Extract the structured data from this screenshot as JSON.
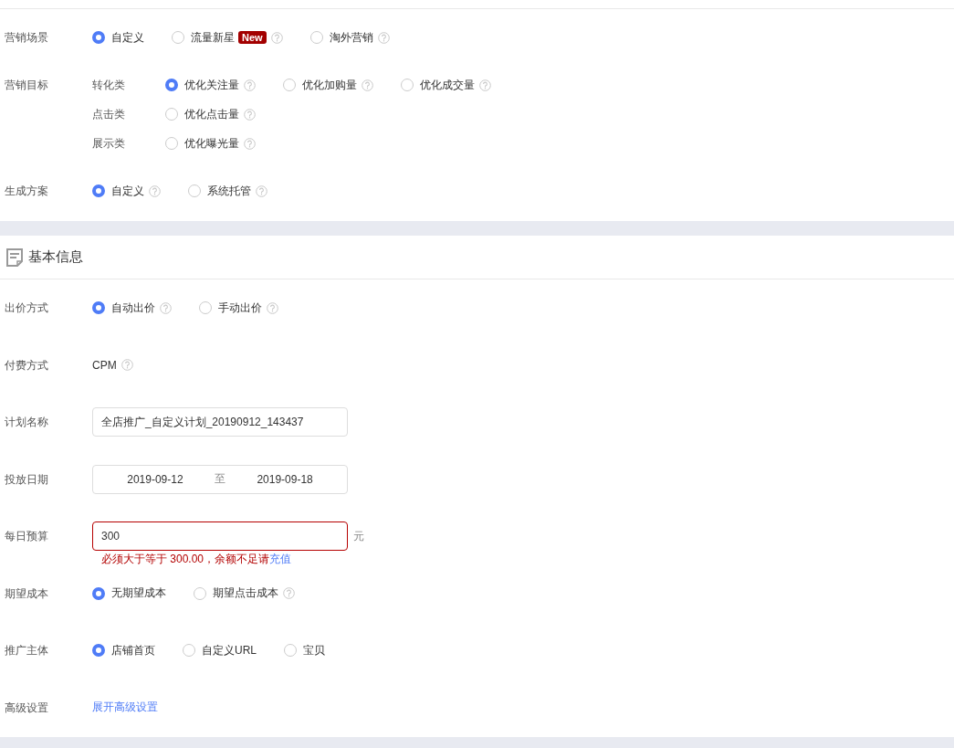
{
  "section_1": {
    "rows": [
      {
        "kind": "radio",
        "label": "营销场景",
        "options": [
          {
            "label": "自定义",
            "selected": true,
            "help": false
          },
          {
            "label": "流量新星",
            "selected": false,
            "help": true,
            "badge": "New"
          },
          {
            "label": "淘外营销",
            "selected": false,
            "help": true
          }
        ]
      },
      {
        "kind": "groups",
        "label": "营销目标",
        "groups": [
          {
            "label": "转化类",
            "options": [
              {
                "label": "优化关注量",
                "selected": true,
                "help": true
              },
              {
                "label": "优化加购量",
                "selected": false,
                "help": true
              },
              {
                "label": "优化成交量",
                "selected": false,
                "help": true
              }
            ]
          },
          {
            "label": "点击类",
            "options": [
              {
                "label": "优化点击量",
                "selected": false,
                "help": true
              }
            ]
          },
          {
            "label": "展示类",
            "options": [
              {
                "label": "优化曝光量",
                "selected": false,
                "help": true
              }
            ]
          }
        ]
      },
      {
        "kind": "radio",
        "label": "生成方案",
        "options": [
          {
            "label": "自定义",
            "selected": true,
            "help": true
          },
          {
            "label": "系统托管",
            "selected": false,
            "help": true
          }
        ]
      }
    ]
  },
  "section_2": {
    "title": "基本信息",
    "rows": [
      {
        "kind": "radio",
        "label": "出价方式",
        "options": [
          {
            "label": "自动出价",
            "selected": true,
            "help": true
          },
          {
            "label": "手动出价",
            "selected": false,
            "help": true
          }
        ]
      },
      {
        "kind": "text",
        "label": "付费方式",
        "value": "CPM",
        "help": true
      },
      {
        "kind": "input",
        "label": "计划名称",
        "value": "全店推广_自定义计划_20190912_143437",
        "error": false
      },
      {
        "kind": "daterange",
        "label": "投放日期",
        "start": "2019-09-12",
        "separator": "至",
        "end": "2019-09-18"
      },
      {
        "kind": "input",
        "label": "每日预算",
        "value": "300",
        "error": true,
        "unit": "元",
        "message": "必须大于等于 300.00，余额不足请",
        "message_link": "充值"
      },
      {
        "kind": "radio",
        "label": "期望成本",
        "options": [
          {
            "label": "无期望成本",
            "selected": true,
            "help": false
          },
          {
            "label": "期望点击成本",
            "selected": false,
            "help": true
          }
        ]
      },
      {
        "kind": "radio",
        "label": "推广主体",
        "options": [
          {
            "label": "店铺首页",
            "selected": true,
            "help": false
          },
          {
            "label": "自定义URL",
            "selected": false,
            "help": false
          },
          {
            "label": "宝贝",
            "selected": false,
            "help": false
          }
        ]
      },
      {
        "kind": "link",
        "label": "高级设置",
        "value": "展开高级设置"
      }
    ]
  }
}
